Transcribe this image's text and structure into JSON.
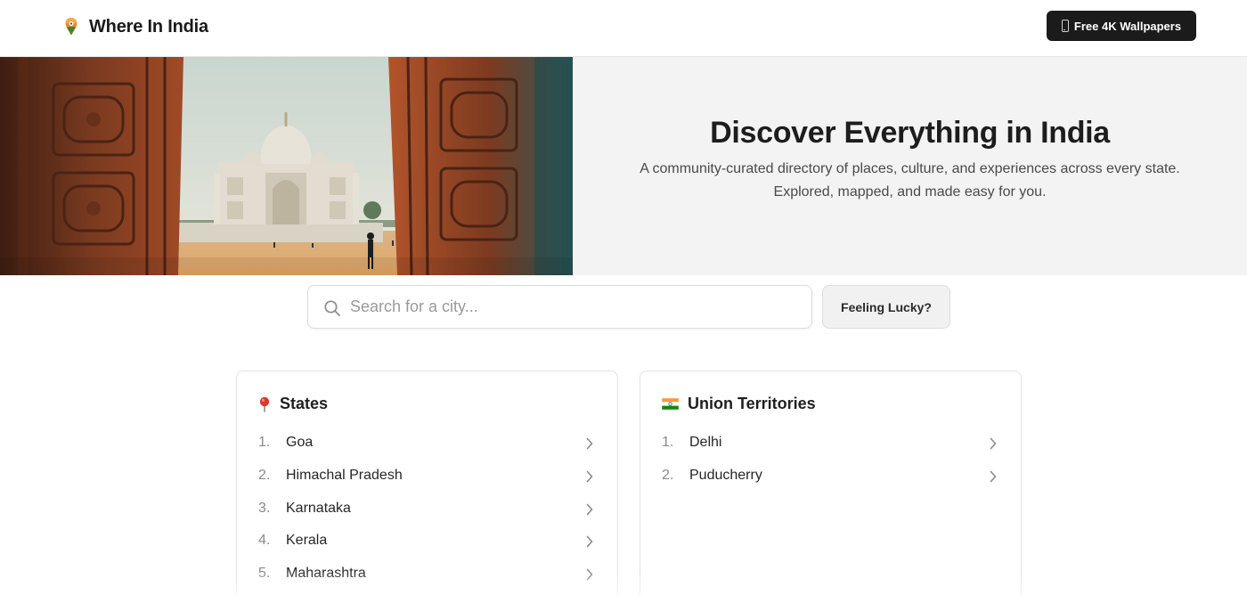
{
  "header": {
    "brand_name": "Where In India",
    "wallpapers_button": "Free 4K Wallpapers"
  },
  "hero": {
    "title": "Discover Everything in India",
    "subtitle_line1": "A community-curated directory of places, culture, and experiences across every state.",
    "subtitle_line2": "Explored, mapped, and made easy for you."
  },
  "search": {
    "placeholder": "Search for a city...",
    "value": "",
    "lucky_button": "Feeling Lucky?"
  },
  "states": {
    "title": "States",
    "items": [
      {
        "num": "1.",
        "name": "Goa"
      },
      {
        "num": "2.",
        "name": "Himachal Pradesh"
      },
      {
        "num": "3.",
        "name": "Karnataka"
      },
      {
        "num": "4.",
        "name": "Kerala"
      },
      {
        "num": "5.",
        "name": "Maharashtra"
      }
    ]
  },
  "union_territories": {
    "title": "Union Territories",
    "items": [
      {
        "num": "1.",
        "name": "Delhi"
      },
      {
        "num": "2.",
        "name": "Puducherry"
      }
    ]
  },
  "icons": {
    "brand": "map-pin-icon",
    "wallpapers": "phone-icon",
    "search": "search-icon",
    "states": "pushpin-icon",
    "union_territories": "india-flag-icon",
    "list_item": "chevron-right-icon"
  },
  "colors": {
    "accent_dark": "#1b1b1b",
    "hero_panel": "#f3f3f3",
    "pin_red": "#d9392b",
    "flag_saffron": "#ff9933",
    "flag_green": "#138808"
  }
}
